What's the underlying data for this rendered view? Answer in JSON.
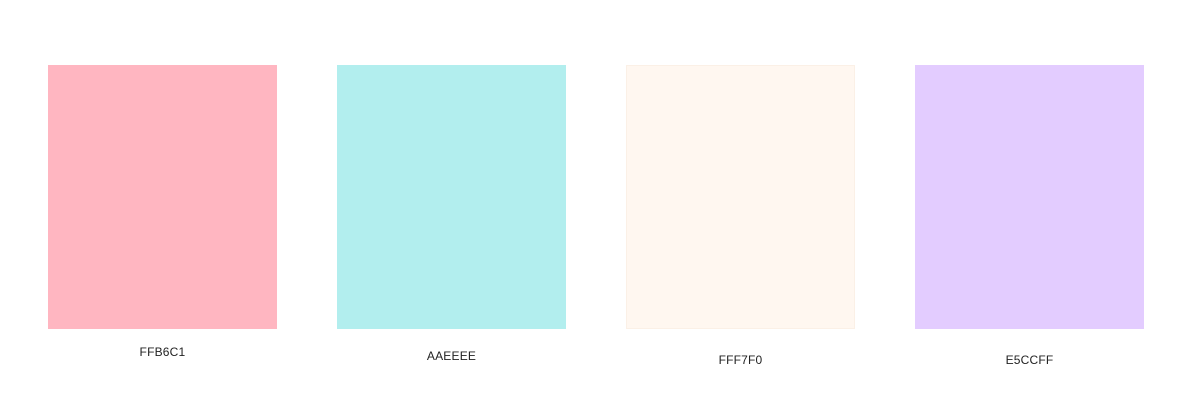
{
  "swatches": [
    {
      "hex_label": "FFB6C1",
      "color": "#FFB6C1"
    },
    {
      "hex_label": "AAEEEE",
      "color": "#B2EEEE"
    },
    {
      "hex_label": "FFF7F0",
      "color": "#FFF7F0"
    },
    {
      "hex_label": "E5CCFF",
      "color": "#E3CCFF"
    }
  ]
}
